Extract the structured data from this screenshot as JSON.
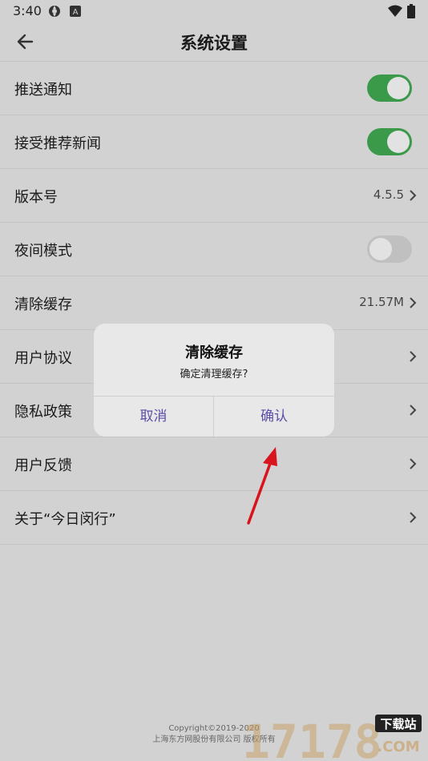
{
  "status_bar": {
    "time": "3:40",
    "left_icons": [
      "sync-icon",
      "a-badge-icon"
    ],
    "right_icons": [
      "wifi-icon",
      "battery-icon"
    ]
  },
  "app_bar": {
    "title": "系统设置",
    "back_icon": "back-arrow-icon"
  },
  "settings": [
    {
      "label": "推送通知",
      "type": "toggle",
      "checked": true
    },
    {
      "label": "接受推荐新闻",
      "type": "toggle",
      "checked": true
    },
    {
      "label": "版本号",
      "type": "value",
      "value": "4.5.5"
    },
    {
      "label": "夜间模式",
      "type": "toggle",
      "checked": false
    },
    {
      "label": "清除缓存",
      "type": "value",
      "value": "21.57M"
    },
    {
      "label": "用户协议",
      "type": "link"
    },
    {
      "label": "隐私政策",
      "type": "link"
    },
    {
      "label": "用户反馈",
      "type": "link"
    },
    {
      "label": "关于“今日闵行”",
      "type": "link"
    }
  ],
  "dialog": {
    "title": "清除缓存",
    "message": "确定清理缓存?",
    "cancel_label": "取消",
    "confirm_label": "确认"
  },
  "footer": {
    "copyright": "Copyright©2019-2020",
    "company": "上海东方网股份有限公司 版权所有"
  },
  "watermark": {
    "number": "17178",
    "tag": "下载站",
    "suffix": ".COM"
  },
  "colors": {
    "toggle_on": "#3a9a4a",
    "dialog_button": "#5b4ea8",
    "annotation_arrow": "#d8141e"
  }
}
